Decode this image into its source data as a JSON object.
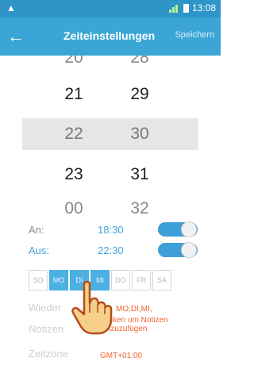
{
  "status": {
    "time": "13:08",
    "warn_icon": "warning-icon"
  },
  "toolbar": {
    "title": "Zeiteinstellungen",
    "save": "Speichern",
    "back_icon": "arrow-left-icon"
  },
  "picker": {
    "hours": [
      "20",
      "21",
      "22",
      "23",
      "00"
    ],
    "minutes": [
      "28",
      "29",
      "30",
      "31",
      "32"
    ],
    "selected_index": 2
  },
  "schedule": {
    "on_label": "An:",
    "on_time": "18:30",
    "on_enabled": true,
    "off_label": "Aus:",
    "off_time": "22:30",
    "off_enabled": true
  },
  "days": [
    {
      "label": "SO",
      "active": false
    },
    {
      "label": "MO",
      "active": true
    },
    {
      "label": "DI",
      "active": true
    },
    {
      "label": "MI",
      "active": true
    },
    {
      "label": "DO",
      "active": false
    },
    {
      "label": "FR",
      "active": false
    },
    {
      "label": "SA",
      "active": false
    }
  ],
  "info": {
    "repeat_label": "Wieder",
    "repeat_value": "MO,DI,MI,",
    "notes_label": "Notizen",
    "notes_value_1": "Klicken um Notizen",
    "notes_value_2": "hinzuzufügen",
    "tz_label": "Zeitzone",
    "tz_value": "GMT+01:00"
  },
  "colors": {
    "accent": "#3ba6d6",
    "status": "#2f95c8",
    "alert_text": "#f1642c"
  }
}
